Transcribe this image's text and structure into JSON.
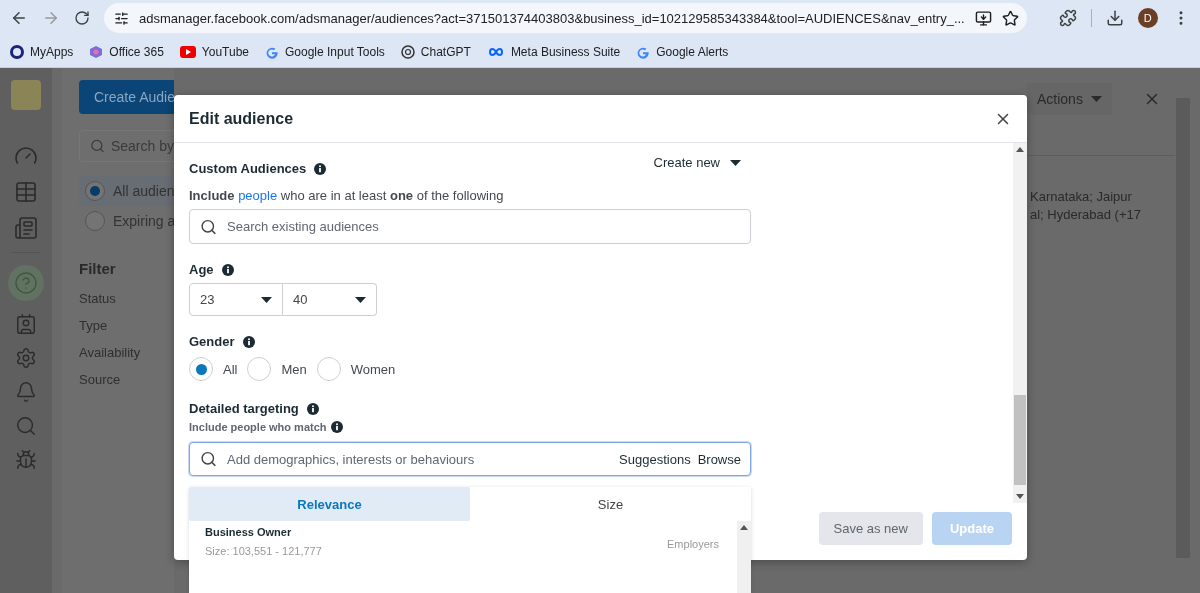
{
  "browser": {
    "url": "adsmanager.facebook.com/adsmanager/audiences?act=371501374403803&business_id=102129585343384&tool=AUDIENCES&nav_entry_...",
    "profile_initial": "D",
    "bookmarks": [
      {
        "label": "MyApps",
        "kind": "ring"
      },
      {
        "label": "Office 365",
        "kind": "office"
      },
      {
        "label": "YouTube",
        "kind": "youtube"
      },
      {
        "label": "Google Input Tools",
        "kind": "google"
      },
      {
        "label": "ChatGPT",
        "kind": "chatgpt"
      },
      {
        "label": "Meta Business Suite",
        "kind": "meta"
      },
      {
        "label": "Google Alerts",
        "kind": "google"
      }
    ]
  },
  "background": {
    "create_button": "Create Audie",
    "search_placeholder": "Search by",
    "audience_filters": [
      {
        "label": "All audien",
        "selected": true
      },
      {
        "label": "Expiring a",
        "selected": false
      }
    ],
    "filter_title": "Filter",
    "filters": [
      "Status",
      "Type",
      "Availability",
      "Source"
    ],
    "actions_button": "Actions",
    "location_lines": [
      "Karnataka; Jaipur",
      "al; Hyderabad (+17"
    ]
  },
  "modal": {
    "title": "Edit audience",
    "custom_audiences": {
      "label": "Custom Audiences",
      "create_new": "Create new",
      "intro_lead": "**Include**",
      "intro_link": "people",
      "intro_rest": "who are in at least **one** of the following",
      "search_placeholder": "Search existing audiences"
    },
    "age": {
      "label": "Age",
      "min": "23",
      "max": "40"
    },
    "gender": {
      "label": "Gender",
      "options": [
        {
          "label": "All",
          "selected": true
        },
        {
          "label": "Men",
          "selected": false
        },
        {
          "label": "Women",
          "selected": false
        }
      ]
    },
    "detailed_targeting": {
      "label": "Detailed targeting",
      "hint": "Include people who match",
      "placeholder": "Add demographics, interests or behaviours",
      "suggestions": "Suggestions",
      "browse": "Browse"
    },
    "sort_tabs": [
      {
        "label": "Relevance",
        "selected": true
      },
      {
        "label": "Size",
        "selected": false
      }
    ],
    "results": [
      {
        "name": "Business Owner",
        "size": "Size: 103,551 - 121,777",
        "category": "Employers"
      }
    ],
    "save_button": "Save as new",
    "update_button": {
      "label": "Update",
      "disabled": true
    }
  }
}
